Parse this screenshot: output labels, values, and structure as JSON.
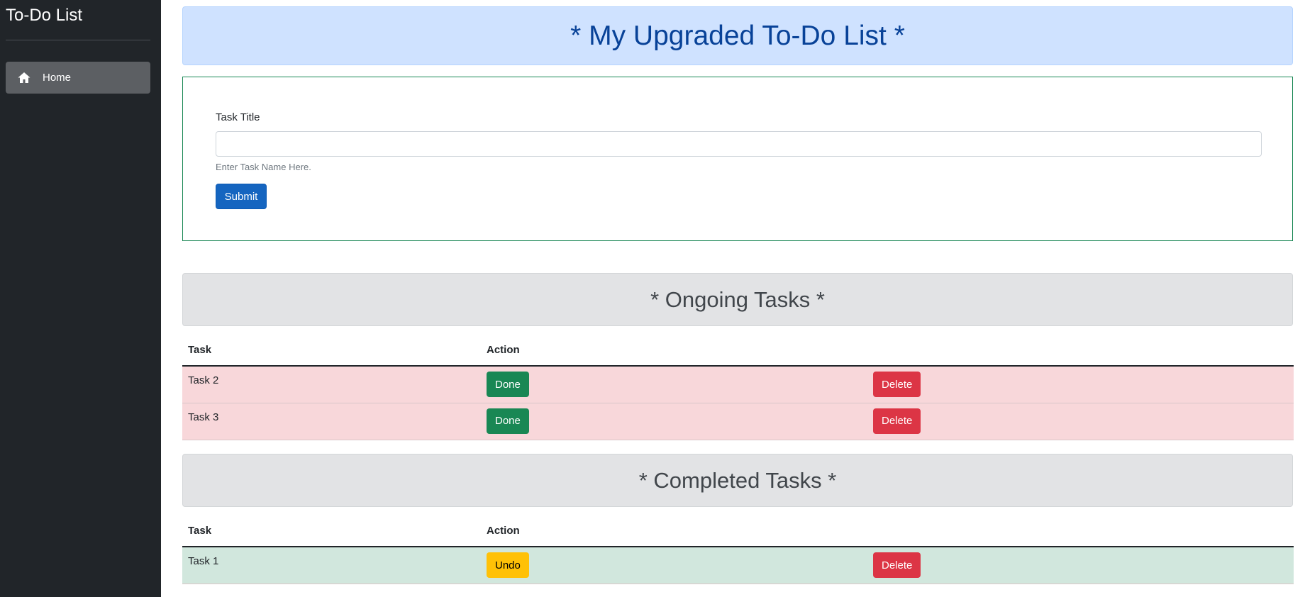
{
  "sidebar": {
    "brand": "To-Do List",
    "items": [
      {
        "label": "Home",
        "icon": "home-icon"
      }
    ]
  },
  "header": {
    "title": "* My Upgraded To-Do List *"
  },
  "form": {
    "label": "Task Title",
    "value": "",
    "help": "Enter Task Name Here.",
    "submit_label": "Submit"
  },
  "ongoing": {
    "title": "* Ongoing Tasks *",
    "columns": [
      "Task",
      "Action"
    ],
    "rows": [
      {
        "task": "Task 2",
        "primary_action": "Done",
        "delete_label": "Delete"
      },
      {
        "task": "Task 3",
        "primary_action": "Done",
        "delete_label": "Delete"
      }
    ]
  },
  "completed": {
    "title": "* Completed Tasks *",
    "columns": [
      "Task",
      "Action"
    ],
    "rows": [
      {
        "task": "Task 1",
        "primary_action": "Undo",
        "delete_label": "Delete"
      }
    ]
  },
  "colors": {
    "sidebar_bg": "#212529",
    "primary": "#1565c0",
    "success": "#198754",
    "danger": "#dc3545",
    "warning": "#ffc107",
    "info_banner": "#cfe2ff",
    "secondary_banner": "#e2e3e5",
    "row_ongoing": "#f8d7da",
    "row_completed": "#d1e7dd"
  }
}
